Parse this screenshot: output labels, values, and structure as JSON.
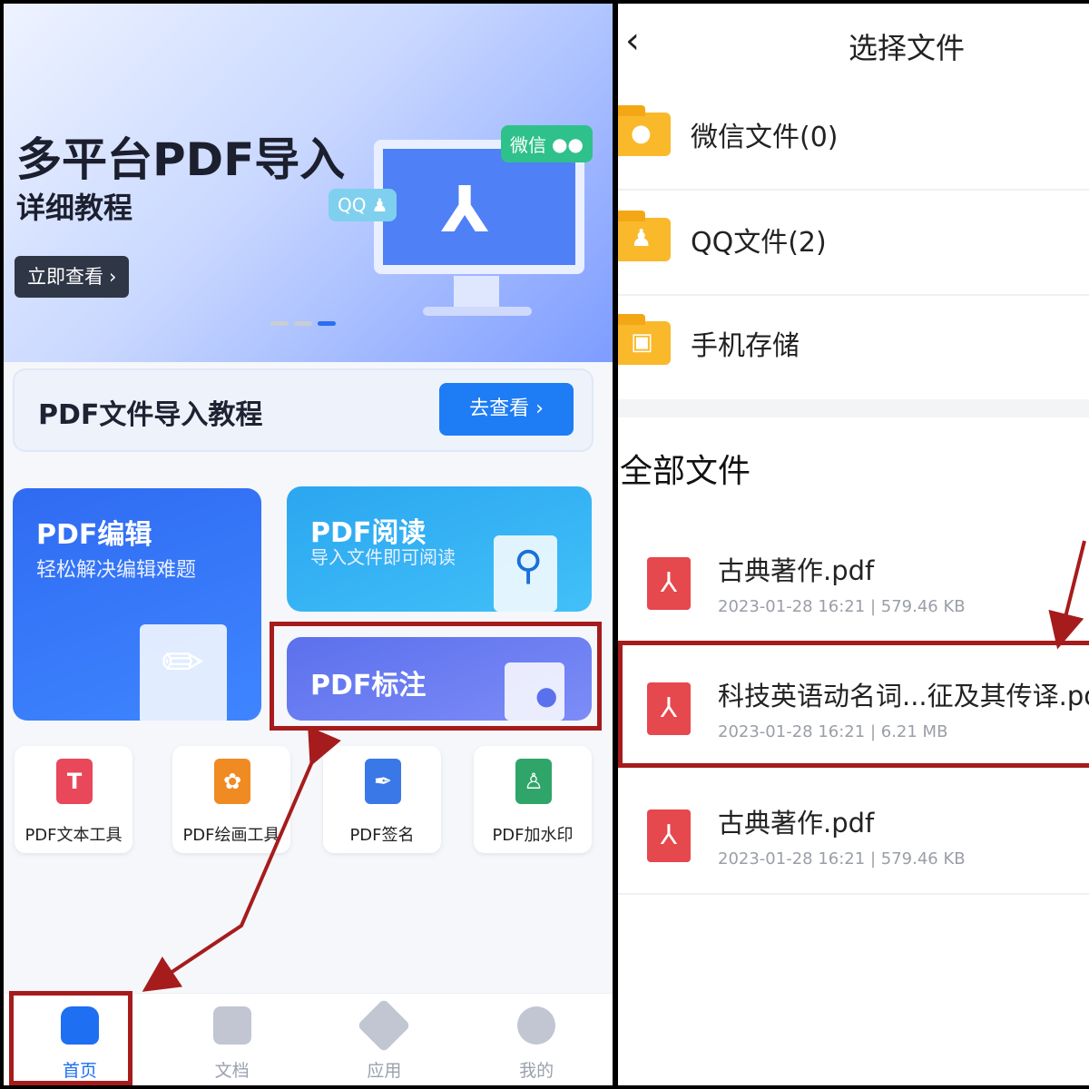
{
  "home": {
    "banner": {
      "title": "多平台PDF导入",
      "subtitle": "详细教程",
      "button_label": "立即查看",
      "button_icon": "chevron-right-icon",
      "wechat_badge": "微信",
      "qq_badge": "QQ",
      "page_indicator": {
        "count": 3,
        "active": 3
      }
    },
    "tutorial": {
      "title": "PDF文件导入教程",
      "button_label": "去查看"
    },
    "cards": {
      "edit": {
        "title": "PDF编辑",
        "subtitle": "轻松解决编辑难题"
      },
      "read": {
        "title": "PDF阅读",
        "subtitle": "导入文件即可阅读"
      },
      "annotate": {
        "title": "PDF标注"
      }
    },
    "tools": [
      {
        "label": "PDF文本工具",
        "icon": "text-tool-icon",
        "color": "#e9475a"
      },
      {
        "label": "PDF绘画工具",
        "icon": "paint-palette-icon",
        "color": "#f08a22"
      },
      {
        "label": "PDF签名",
        "icon": "signature-pen-icon",
        "color": "#3a78e8"
      },
      {
        "label": "PDF加水印",
        "icon": "watermark-stamp-icon",
        "color": "#2fa56a"
      }
    ],
    "nav": [
      {
        "label": "首页",
        "icon": "home-icon",
        "active": true
      },
      {
        "label": "文档",
        "icon": "document-icon",
        "active": false
      },
      {
        "label": "应用",
        "icon": "apps-cube-icon",
        "active": false
      },
      {
        "label": "我的",
        "icon": "profile-icon",
        "active": false
      }
    ],
    "accent_color": "#1e6ff2",
    "annotation_color": "#a61c1c"
  },
  "picker": {
    "title": "选择文件",
    "folders": [
      {
        "label": "微信文件(0)",
        "icon": "wechat-folder-icon"
      },
      {
        "label": "QQ文件(2)",
        "icon": "qq-folder-icon"
      },
      {
        "label": "手机存储",
        "icon": "phone-storage-folder-icon"
      }
    ],
    "section_title": "全部文件",
    "files": [
      {
        "name": "古典著作.pdf",
        "date": "2023-01-28 16:21",
        "size": "579.46 KB"
      },
      {
        "name": "科技英语动名词...征及其传译.pdf",
        "date": "2023-01-28 16:21",
        "size": "6.21 MB"
      },
      {
        "name": "古典著作.pdf",
        "date": "2023-01-28 16:21",
        "size": "579.46 KB"
      }
    ],
    "meta_separator": "|"
  }
}
